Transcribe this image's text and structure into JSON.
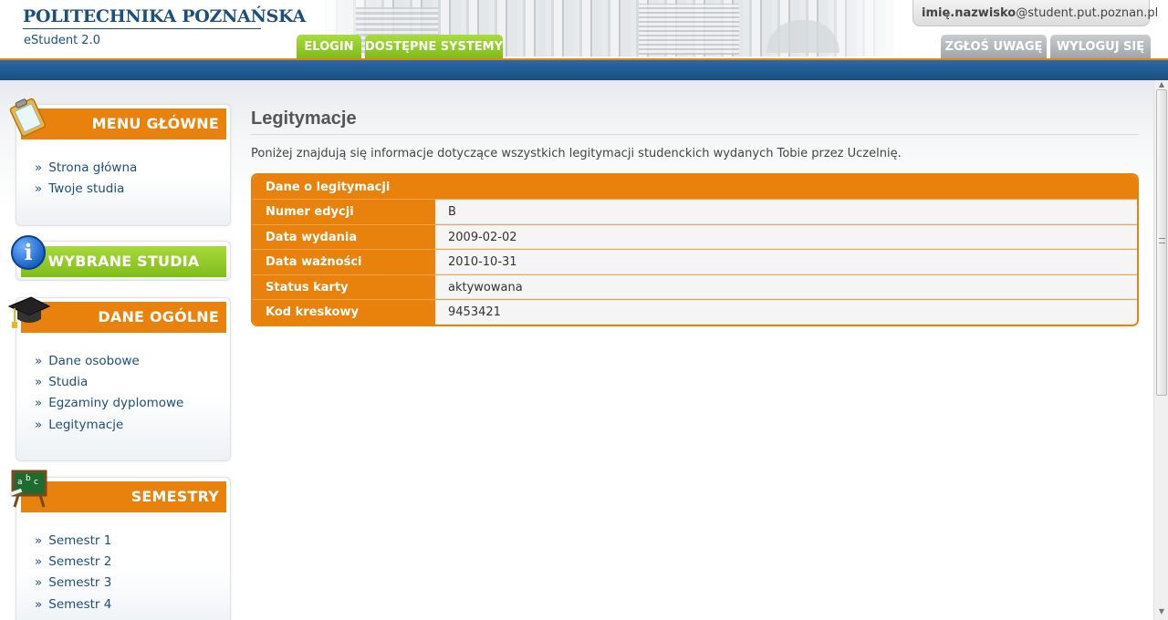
{
  "header": {
    "logo_title": "POLITECHNIKA POZNAŃSKA",
    "logo_subtitle": "eStudent 2.0",
    "tabs": [
      {
        "label": "ELOGIN"
      },
      {
        "label": "DOSTĘPNE SYSTEMY"
      }
    ],
    "user": {
      "name_bold": "imię.nazwisko",
      "domain": "@student.put.poznan.pl"
    },
    "actions": [
      {
        "label": "ZGŁOŚ UWAGĘ"
      },
      {
        "label": "WYLOGUJ SIĘ"
      }
    ]
  },
  "sidebar": {
    "menu_glowne": {
      "title": "MENU GŁÓWNE",
      "items": [
        {
          "label": "Strona główna"
        },
        {
          "label": "Twoje studia"
        }
      ]
    },
    "wybrane_studia": {
      "title": "WYBRANE STUDIA"
    },
    "dane_ogolne": {
      "title": "DANE OGÓLNE",
      "items": [
        {
          "label": "Dane osobowe"
        },
        {
          "label": "Studia"
        },
        {
          "label": "Egzaminy dyplomowe"
        },
        {
          "label": "Legitymacje"
        }
      ]
    },
    "semestry": {
      "title": "SEMESTRY",
      "items": [
        {
          "label": "Semestr 1"
        },
        {
          "label": "Semestr 2"
        },
        {
          "label": "Semestr 3"
        },
        {
          "label": "Semestr 4"
        }
      ]
    }
  },
  "main": {
    "title": "Legitymacje",
    "description": "Poniżej znajdują się informacje dotyczące wszystkich legitymacji studenckich wydanych Tobie przez Uczelnię.",
    "card": {
      "title": "Dane o legitymacji",
      "rows": [
        {
          "label": "Numer edycji",
          "value": "B"
        },
        {
          "label": "Data wydania",
          "value": "2009-02-02"
        },
        {
          "label": "Data ważności",
          "value": "2010-10-31"
        },
        {
          "label": "Status karty",
          "value": "aktywowana"
        },
        {
          "label": "Kod kreskowy",
          "value": "9453421"
        }
      ]
    }
  },
  "colors": {
    "orange": "#e8820c",
    "green": "#8cc92a",
    "blue": "#1d4f7a"
  },
  "icons": [
    "clipboard-icon",
    "info-icon",
    "graduation-cap-icon",
    "chalkboard-icon"
  ]
}
